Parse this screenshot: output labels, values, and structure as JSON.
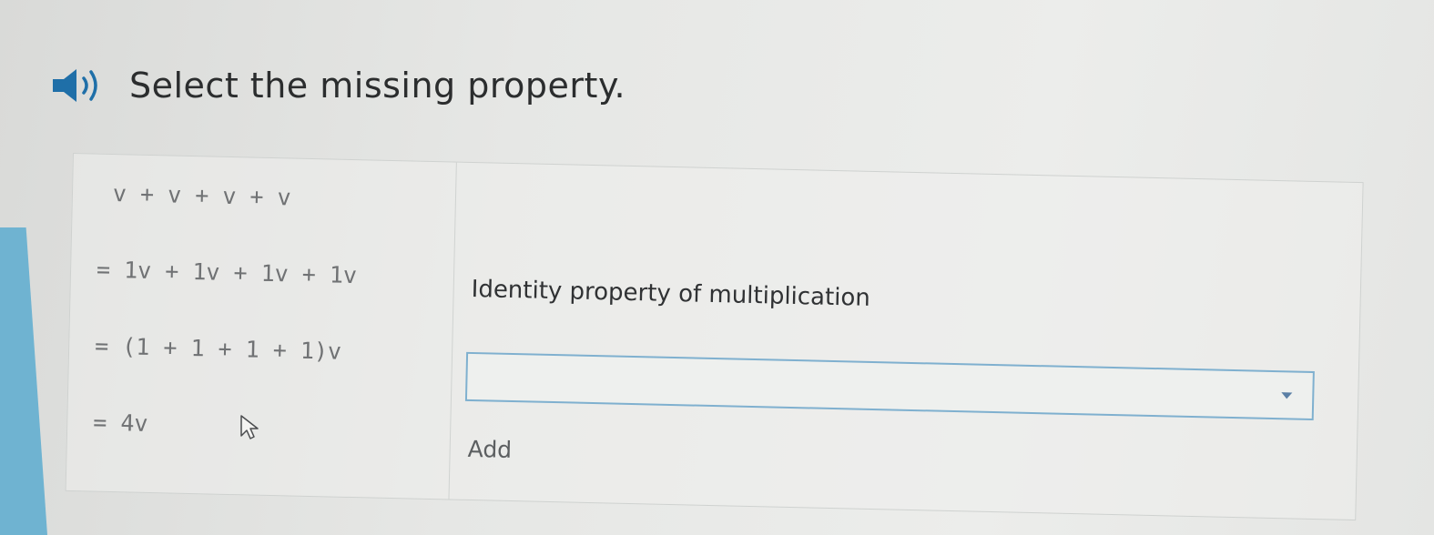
{
  "prompt": {
    "text": "Select the missing property.",
    "icon": "speaker-icon"
  },
  "steps": [
    "v + v + v + v",
    "= 1v + 1v + 1v + 1v",
    "= (1 + 1 + 1 + 1)v",
    "= 4v"
  ],
  "reasons": {
    "step2": "Identity property of multiplication"
  },
  "dropdown": {
    "selected": ""
  },
  "add_label": "Add",
  "colors": {
    "accent": "#7fb0cf",
    "stripe": "#6fb3d1"
  }
}
